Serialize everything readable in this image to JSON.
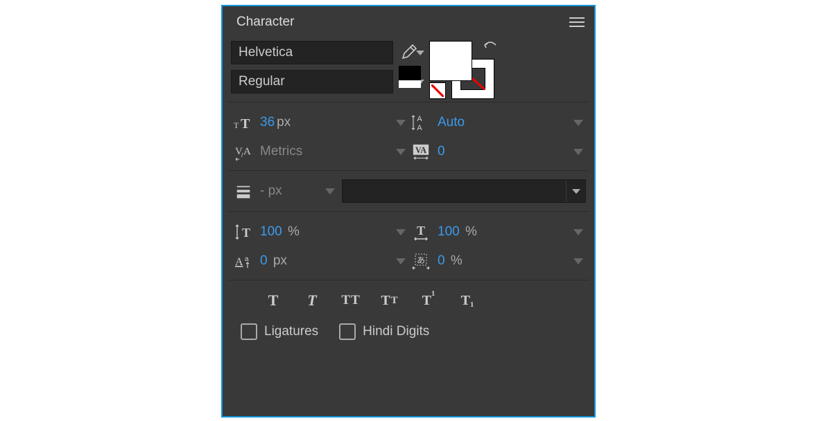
{
  "panel_title": "Character",
  "font_family": "Helvetica",
  "font_style": "Regular",
  "font_size": {
    "value": "36",
    "unit": "px"
  },
  "leading": {
    "value": "Auto"
  },
  "kerning": {
    "value": "Metrics"
  },
  "tracking": {
    "value": "0"
  },
  "stroke_width": {
    "value": "-",
    "unit": "px"
  },
  "stroke_style": "",
  "vscale": {
    "value": "100",
    "unit": "%"
  },
  "hscale": {
    "value": "100",
    "unit": "%"
  },
  "baseline_shift": {
    "value": "0",
    "unit": "px"
  },
  "tsume": {
    "value": "0",
    "unit": "%"
  },
  "faux": {
    "bold": "T",
    "italic": "T",
    "allcaps": "TT",
    "smallcaps": "T",
    "smallcaps_s": "T",
    "super": "T",
    "super_s": "1",
    "sub": "T",
    "sub_s": "1"
  },
  "checks": {
    "ligatures_label": "Ligatures",
    "hindi_label": "Hindi Digits"
  },
  "colors": {
    "fill": "#ffffff",
    "stroke": "none"
  }
}
